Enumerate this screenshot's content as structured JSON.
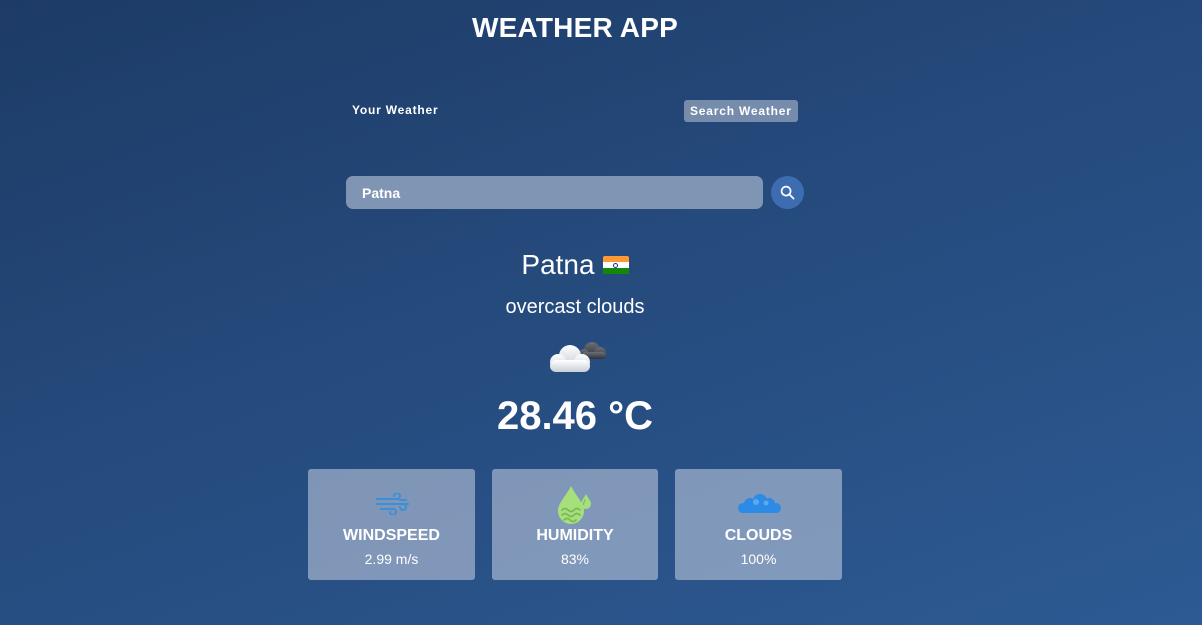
{
  "app": {
    "title": "WEATHER APP"
  },
  "tabs": {
    "your_weather": "Your Weather",
    "search_weather": "Search Weather",
    "active": "search_weather"
  },
  "search": {
    "value": "Patna",
    "icon": "search-icon"
  },
  "location": {
    "city": "Patna",
    "flag": "india-flag"
  },
  "weather": {
    "description": "overcast clouds",
    "icon": "overcast-clouds-icon",
    "temperature": "28.46 °C"
  },
  "stats": [
    {
      "label": "WINDSPEED",
      "value": "2.99 m/s",
      "icon": "wind-icon"
    },
    {
      "label": "HUMIDITY",
      "value": "83%",
      "icon": "humidity-icon"
    },
    {
      "label": "CLOUDS",
      "value": "100%",
      "icon": "clouds-icon"
    }
  ],
  "colors": {
    "background_top": "#1d3b66",
    "background_bottom": "#2d5a93",
    "search_button": "#3d6db0",
    "wind_icon": "#3a8fd8",
    "humidity_icon": "#a5e07a",
    "clouds_icon": "#2b8be6"
  }
}
